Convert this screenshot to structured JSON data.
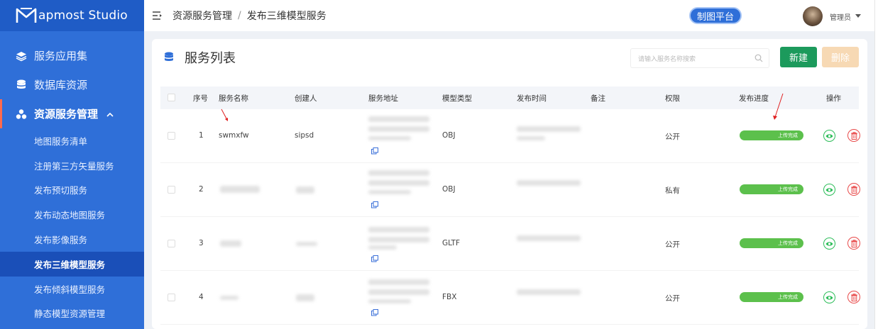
{
  "app": {
    "logo_text": "apmost Studio"
  },
  "sidebar": {
    "menu": [
      {
        "label": "服务应用集",
        "icon": "layers-icon"
      },
      {
        "label": "数据库资源",
        "icon": "database-icon"
      },
      {
        "label": "资源服务管理",
        "icon": "cluster-icon",
        "expanded": true
      }
    ],
    "submenu": [
      {
        "label": "地图服务清单"
      },
      {
        "label": "注册第三方矢量服务"
      },
      {
        "label": "发布预切服务"
      },
      {
        "label": "发布动态地图服务"
      },
      {
        "label": "发布影像服务"
      },
      {
        "label": "发布三维模型服务",
        "active": true
      },
      {
        "label": "发布倾斜模型服务"
      },
      {
        "label": "静态模型资源管理"
      }
    ]
  },
  "header": {
    "breadcrumb_root": "资源服务管理",
    "breadcrumb_sep": "/",
    "breadcrumb_current": "发布三维模型服务",
    "map_platform": "制图平台",
    "user_name": "管理员"
  },
  "panel": {
    "title": "服务列表",
    "search_placeholder": "请输入服务名称搜索",
    "new_label": "新建",
    "delete_label": "删除"
  },
  "table": {
    "columns": [
      "序号",
      "服务名称",
      "创建人",
      "服务地址",
      "模型类型",
      "发布时间",
      "备注",
      "权限",
      "发布进度",
      "操作"
    ],
    "rows": [
      {
        "index": "1",
        "name": "swmxfw",
        "creator": "sipsd",
        "model_type": "OBJ",
        "permission": "公开",
        "progress_label": "上传完成",
        "progress": 100
      },
      {
        "index": "2",
        "name": "",
        "creator": "",
        "model_type": "OBJ",
        "permission": "私有",
        "progress_label": "上传完成",
        "progress": 100
      },
      {
        "index": "3",
        "name": "",
        "creator": "",
        "model_type": "GLTF",
        "permission": "公开",
        "progress_label": "上传完成",
        "progress": 100
      },
      {
        "index": "4",
        "name": "",
        "creator": "",
        "model_type": "FBX",
        "permission": "公开",
        "progress_label": "上传完成",
        "progress": 100
      }
    ]
  },
  "colors": {
    "sidebar": "#2f6fd8",
    "sidebar_active": "#1a4fb8",
    "new_button": "#1c9a5c",
    "delete_button": "#f7d9b4",
    "progress": "#5cc04c",
    "view": "#2ebd5a",
    "trash": "#e84a4a"
  }
}
